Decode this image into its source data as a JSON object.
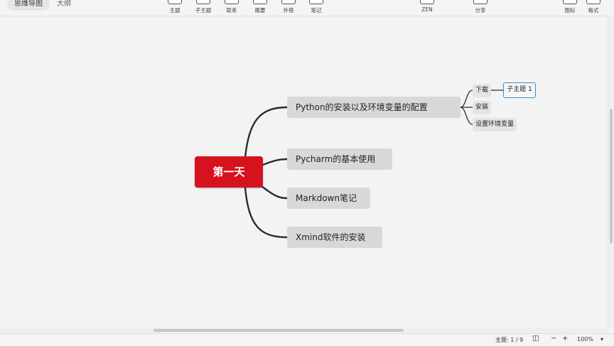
{
  "toolbar": {
    "view_tabs": [
      "思维导图",
      "大纲"
    ],
    "tools": [
      "主题",
      "子主题",
      "联系",
      "概要",
      "外框",
      "笔记",
      "ZEN",
      "分享",
      "图标",
      "格式"
    ]
  },
  "mindmap": {
    "central": "第一天",
    "topics": [
      "Python的安装以及环境变量的配置",
      "Pycharm的基本使用",
      "Markdown笔记",
      "Xmind软件的安装"
    ],
    "subtopics": [
      "下载",
      "安装",
      "设置环境变量"
    ],
    "subsubtopic": "子主题 1"
  },
  "status": {
    "topic_count": "主题: 1 / 9",
    "zoom_minus": "−",
    "zoom_plus": "+",
    "zoom_value": "100%"
  },
  "colors": {
    "central": "#d7121f",
    "topic_bg": "#d8d8d8",
    "selection": "#2f8fd6"
  }
}
